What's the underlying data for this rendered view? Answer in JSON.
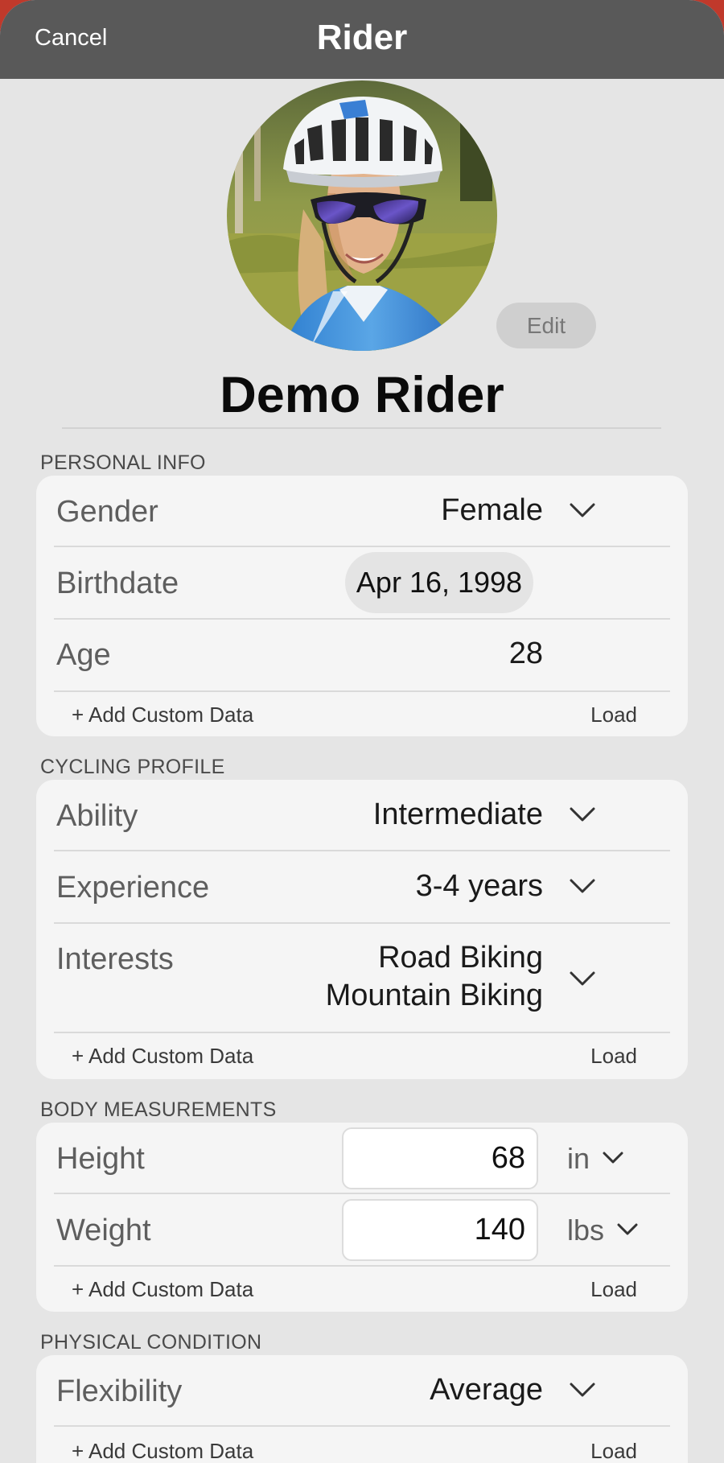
{
  "nav": {
    "cancel": "Cancel",
    "title": "Rider"
  },
  "profile": {
    "name": "Demo Rider",
    "edit_label": "Edit"
  },
  "personal_info": {
    "header": "PERSONAL INFO",
    "gender_label": "Gender",
    "gender_value": "Female",
    "birthdate_label": "Birthdate",
    "birthdate_value": "Apr 16, 1998",
    "age_label": "Age",
    "age_value": "28",
    "add_custom": "+ Add Custom Data",
    "load": "Load"
  },
  "cycling_profile": {
    "header": "CYCLING PROFILE",
    "ability_label": "Ability",
    "ability_value": "Intermediate",
    "experience_label": "Experience",
    "experience_value": "3-4 years",
    "interests_label": "Interests",
    "interests_value_1": "Road Biking",
    "interests_value_2": "Mountain Biking",
    "add_custom": "+ Add Custom Data",
    "load": "Load"
  },
  "body_measurements": {
    "header": "BODY MEASUREMENTS",
    "height_label": "Height",
    "height_value": "68",
    "height_unit": "in",
    "weight_label": "Weight",
    "weight_value": "140",
    "weight_unit": "lbs",
    "add_custom": "+ Add Custom Data",
    "load": "Load"
  },
  "physical_condition": {
    "header": "PHYSICAL CONDITION",
    "flexibility_label": "Flexibility",
    "flexibility_value": "Average",
    "add_custom": "+ Add Custom Data",
    "load": "Load"
  },
  "colors": {
    "nav_bg": "#595959",
    "page_bg": "#e5e5e5",
    "card_bg": "#f5f5f5",
    "edge_accent": "#c0392b"
  },
  "icons": [
    "chevron-down-icon",
    "rider-avatar-photo"
  ]
}
